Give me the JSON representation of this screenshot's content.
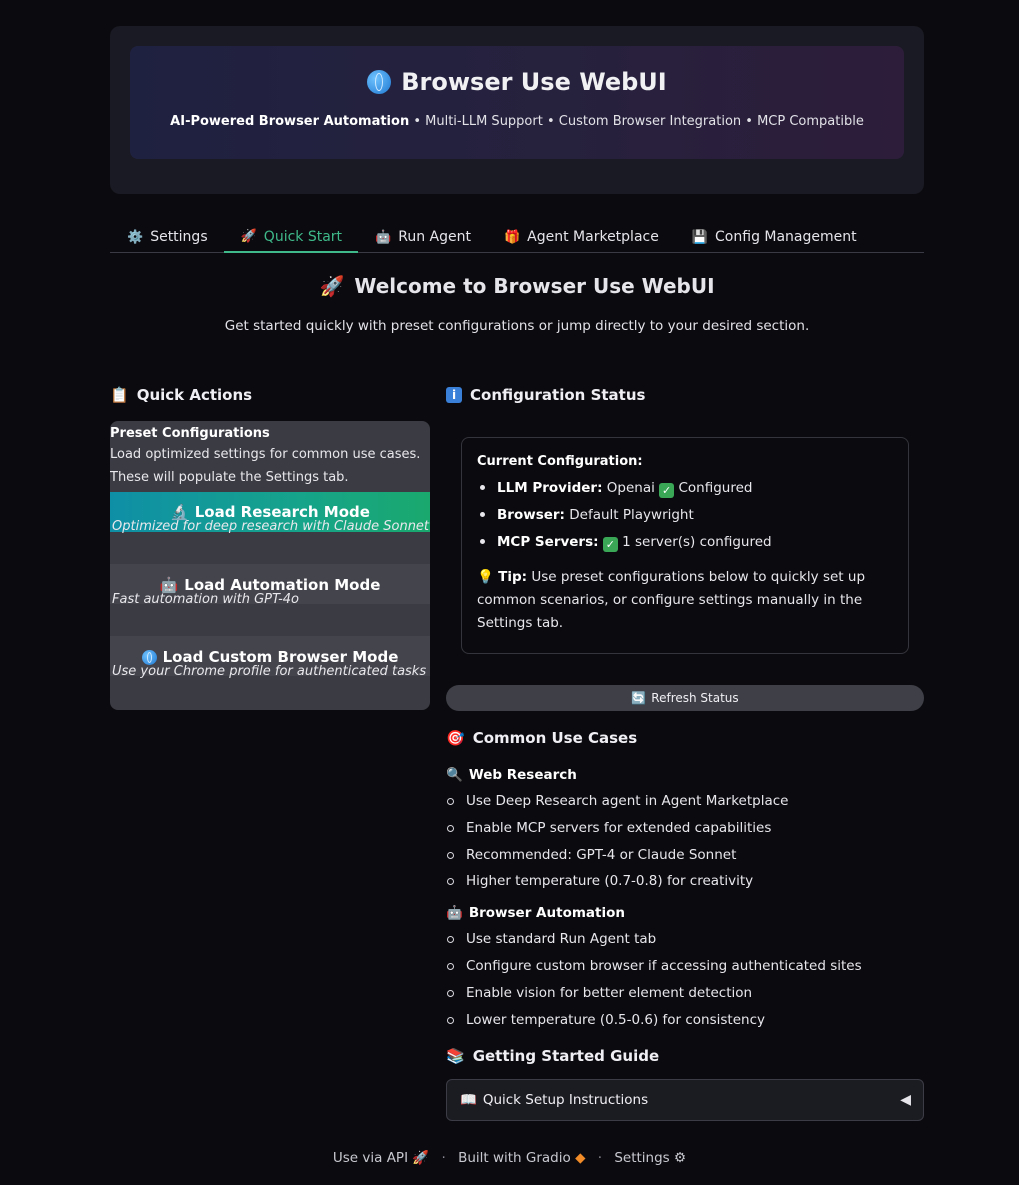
{
  "header": {
    "title": "Browser Use WebUI",
    "subtitle_bold": "AI-Powered Browser Automation",
    "subtitle_rest": " • Multi-LLM Support • Custom Browser Integration • MCP Compatible"
  },
  "tabs": [
    {
      "icon": "⚙️",
      "label": "Settings"
    },
    {
      "icon": "🚀",
      "label": "Quick Start"
    },
    {
      "icon": "🤖",
      "label": "Run Agent"
    },
    {
      "icon": "🎁",
      "label": "Agent Marketplace"
    },
    {
      "icon": "💾",
      "label": "Config Management"
    }
  ],
  "active_tab": "Quick Start",
  "welcome": {
    "title": "Welcome to Browser Use WebUI",
    "subtitle": "Get started quickly with preset configurations or jump directly to your desired section."
  },
  "quick_actions": {
    "title": "Quick Actions",
    "preset_title": "Preset Configurations",
    "preset_desc": "Load optimized settings for common use cases. These will populate the Settings tab.",
    "buttons": [
      {
        "label": "Load Research Mode",
        "desc": "Optimized for deep research with Claude Sonnet"
      },
      {
        "label": "Load Automation Mode",
        "desc": "Fast automation with GPT-4o"
      },
      {
        "label": "Load Custom Browser Mode",
        "desc": "Use your Chrome profile for authenticated tasks"
      }
    ]
  },
  "config_status": {
    "title": "Configuration Status",
    "current_label": "Current Configuration:",
    "llm_label": "LLM Provider:",
    "llm_value": "Openai",
    "llm_status": "Configured",
    "browser_label": "Browser:",
    "browser_value": "Default Playwright",
    "mcp_label": "MCP Servers:",
    "mcp_value": "1 server(s) configured",
    "tip_label": "Tip:",
    "tip_text": "Use preset configurations below to quickly set up common scenarios, or configure settings manually in the Settings tab.",
    "refresh_label": "Refresh Status"
  },
  "use_cases": {
    "title": "Common Use Cases",
    "web_research": {
      "title": "Web Research",
      "items": [
        "Use Deep Research agent in Agent Marketplace",
        "Enable MCP servers for extended capabilities",
        "Recommended: GPT-4 or Claude Sonnet",
        "Higher temperature (0.7-0.8) for creativity"
      ]
    },
    "browser_automation": {
      "title": "Browser Automation",
      "items": [
        "Use standard Run Agent tab",
        "Configure custom browser if accessing authenticated sites",
        "Enable vision for better element detection",
        "Lower temperature (0.5-0.6) for consistency"
      ]
    }
  },
  "guide": {
    "title": "Getting Started Guide",
    "accordion_label": "Quick Setup Instructions",
    "accordion_icon": "◀"
  },
  "footer": {
    "api": "Use via API",
    "built": "Built with Gradio",
    "settings": "Settings"
  }
}
